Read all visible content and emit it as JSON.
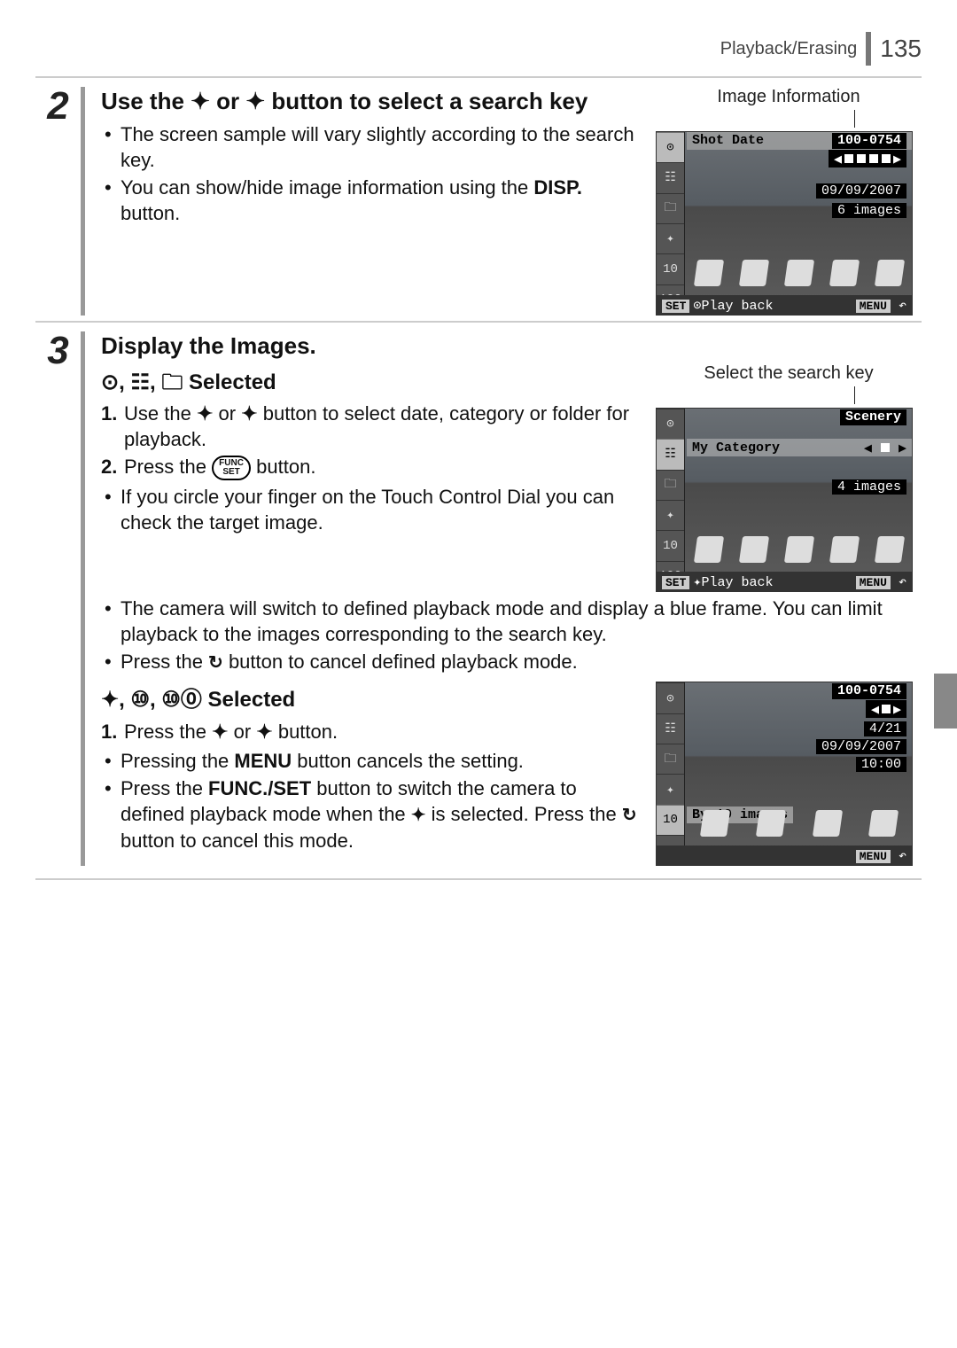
{
  "header": {
    "section": "Playback/Erasing",
    "page": "135"
  },
  "step2": {
    "num": "2",
    "title_pre": "Use the ",
    "title_mid": " or ",
    "title_post": " button to select a search key",
    "bul1": "The screen sample will vary slightly according to the search key.",
    "bul2_pre": "You can show/hide image information using the ",
    "bul2_bold": "DISP.",
    "bul2_post": " button.",
    "img_label": "Image Information",
    "lcd": {
      "top_left": "Shot Date",
      "top_right": "100-0754",
      "date": "09/09/2007",
      "count": "6 images",
      "bottom_left": "Play back",
      "set": "SET",
      "menu": "MENU"
    }
  },
  "step3": {
    "num": "3",
    "title": "Display the Images.",
    "subA": "Selected",
    "a1_pre": "Use the ",
    "a1_mid": " or ",
    "a1_post": " button to select date, category or folder for playback.",
    "a2_pre": "Press the ",
    "a2_post": " button.",
    "a_bul1": "If you circle your finger on the Touch Control Dial you can check the target image.",
    "a_bul2": "The camera will switch to defined playback mode and display a blue frame. You can limit playback to the images corresponding to the search key.",
    "a_bul3_pre": "Press the ",
    "a_bul3_post": " button to cancel defined playback mode.",
    "img_labelA": "Select the search key",
    "lcdA": {
      "scenery": "Scenery",
      "cat": "My Category",
      "count": "4 images",
      "bottom_left": "Play back",
      "set": "SET",
      "menu": "MENU"
    },
    "subB": "Selected",
    "b1_pre": "Press the ",
    "b1_mid": " or ",
    "b1_post": " button.",
    "b_bul1_pre": "Pressing the ",
    "b_bul1_bold": "MENU",
    "b_bul1_post": " button cancels the setting.",
    "b_bul2_pre": "Press the ",
    "b_bul2_bold": "FUNC./SET",
    "b_bul2_mid": " button to switch the camera to defined playback mode when the ",
    "b_bul2_mid2": " is selected. Press the ",
    "b_bul2_post": " button to cancel this mode.",
    "lcdB": {
      "top_right": "100-0754",
      "frac": "4/21",
      "date": "09/09/2007",
      "time": "10:00",
      "by": "By 10 images",
      "menu": "MENU"
    }
  }
}
